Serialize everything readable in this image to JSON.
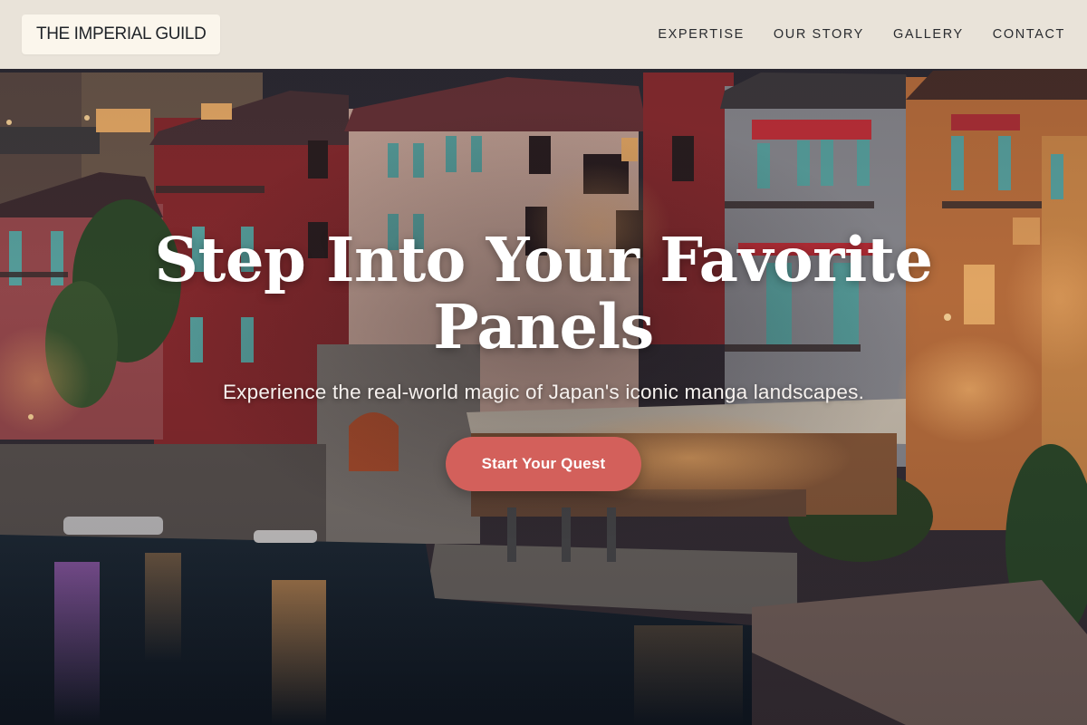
{
  "header": {
    "logo": "THE IMPERIAL GUILD",
    "nav": [
      {
        "label": "EXPERTISE"
      },
      {
        "label": "OUR STORY"
      },
      {
        "label": "GALLERY"
      },
      {
        "label": "CONTACT"
      }
    ]
  },
  "hero": {
    "title": "Step Into Your Favorite Panels",
    "subtitle": "Experience the real-world magic of Japan's iconic manga landscapes.",
    "cta_label": "Start Your Quest",
    "background_image": "lakeside-town-at-dusk-photo"
  },
  "colors": {
    "header_bg": "#f5efe4",
    "cta": "#d3605b",
    "text_light": "#ffffff",
    "text_dark": "#1f2328"
  }
}
